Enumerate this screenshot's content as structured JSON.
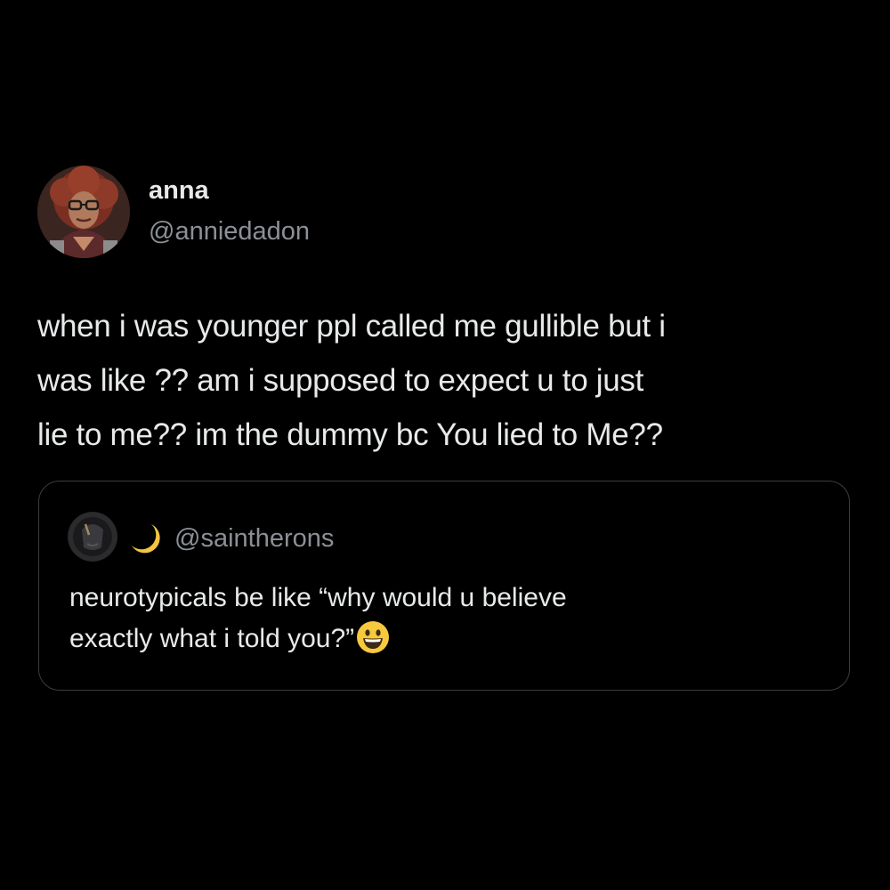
{
  "tweet": {
    "author": {
      "display_name": "anna",
      "handle": "@anniedadon",
      "avatar_icon": "profile-photo-avatar"
    },
    "lines": [
      "when i was younger ppl called me gullible but i",
      "was like ?? am i supposed to expect u to just",
      "lie to me?? im the dummy bc You lied to Me??"
    ]
  },
  "quote_tweet": {
    "handle": "@saintherons",
    "avatar_icon": "dark-profile-avatar",
    "badge_icon": "crescent-moon-icon",
    "lines": [
      "neurotypicals be like “why would u believe",
      "exactly what i told you?”"
    ],
    "emoji_icon": "grinning-face-emoji"
  },
  "colors": {
    "background": "#000000",
    "primary_text": "#e7e9ea",
    "secondary_text": "#8b9096",
    "border": "#3a3d41",
    "moon": "#f4c542",
    "emoji": "#f7c93e"
  }
}
